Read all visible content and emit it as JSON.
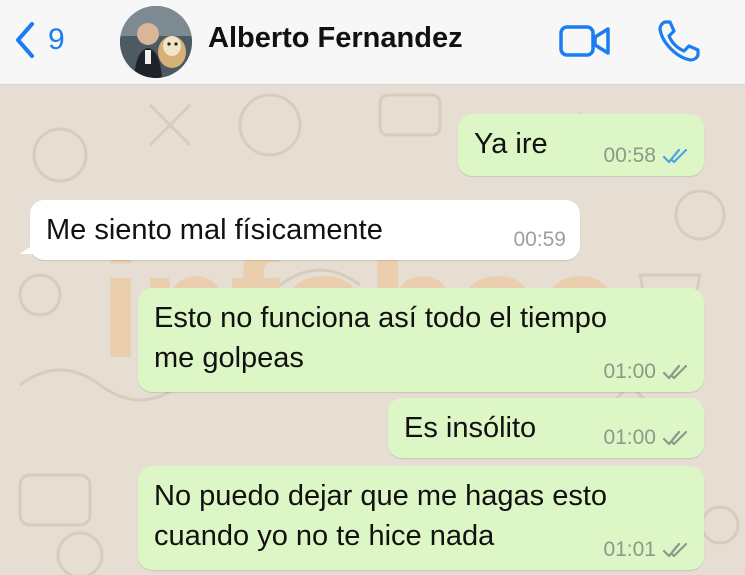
{
  "header": {
    "back_count": "9",
    "contact_name": "Alberto Fernandez"
  },
  "watermark": "infobae",
  "messages": [
    {
      "text": "Ya ire",
      "time": "00:58",
      "direction": "outgoing",
      "status": "read"
    },
    {
      "text": "Me siento mal físicamente",
      "time": "00:59",
      "direction": "incoming"
    },
    {
      "text": "Esto no funciona así todo el tiempo\nme golpeas",
      "time": "01:00",
      "direction": "outgoing",
      "status": "delivered"
    },
    {
      "text": "Es insólito",
      "time": "01:00",
      "direction": "outgoing",
      "status": "delivered"
    },
    {
      "text": "No puedo dejar que me hagas esto\ncuando yo no te hice nada",
      "time": "01:01",
      "direction": "outgoing",
      "status": "delivered"
    }
  ],
  "colors": {
    "accent": "#1a7ef2",
    "outgoing_bubble": "#dcf7c5",
    "incoming_bubble": "#ffffff",
    "read_ticks": "#4fa3e0",
    "delivered_ticks": "#8b9a88"
  },
  "icons": [
    "chevron-left-icon",
    "video-camera-icon",
    "phone-icon",
    "double-check-icon"
  ]
}
